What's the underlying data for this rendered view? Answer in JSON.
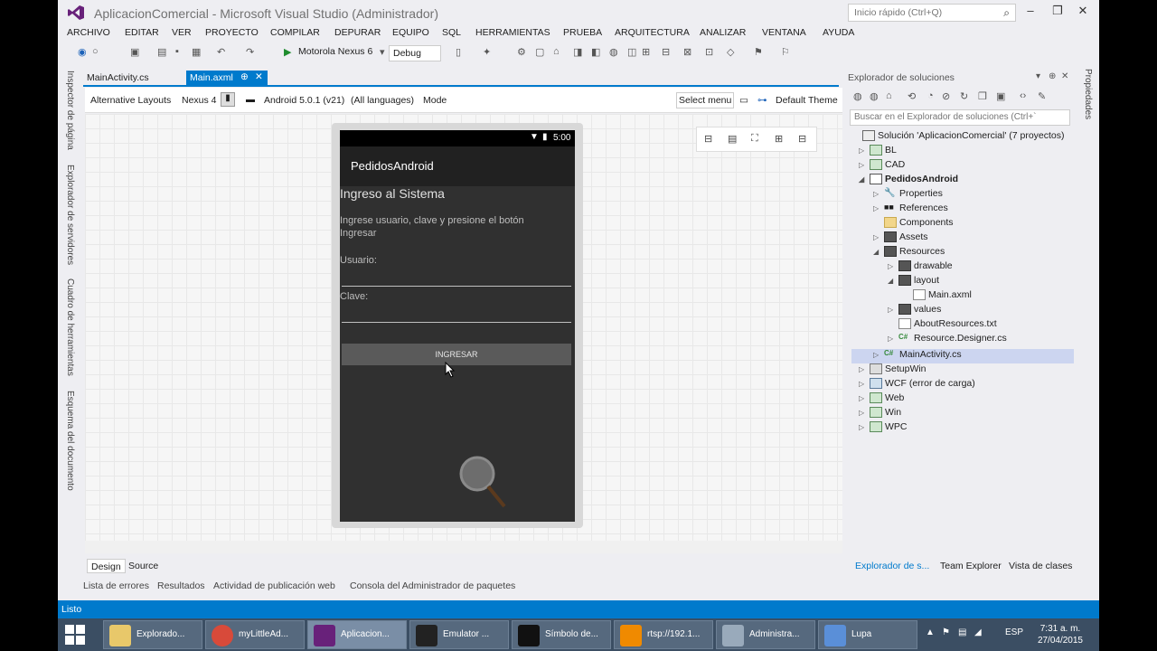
{
  "window": {
    "title": "AplicacionComercial - Microsoft Visual Studio (Administrador)",
    "quick_launch": "Inicio rápido (Ctrl+Q)"
  },
  "menu": [
    "ARCHIVO",
    "EDITAR",
    "VER",
    "PROYECTO",
    "COMPILAR",
    "DEPURAR",
    "EQUIPO",
    "SQL",
    "HERRAMIENTAS",
    "PRUEBA",
    "ARQUITECTURA",
    "ANALIZAR",
    "VENTANA",
    "AYUDA"
  ],
  "toolbar": {
    "device": "Motorola Nexus 6",
    "config": "Debug"
  },
  "left_tabs": [
    "Inspector de página",
    "Explorador de servidores",
    "Cuadro de herramientas",
    "Esquema del documento"
  ],
  "doc_tabs": [
    {
      "label": "MainActivity.cs"
    },
    {
      "label": "Main.axml"
    }
  ],
  "designer_toolbar": {
    "alt_layouts": "Alternative Layouts",
    "device": "Nexus 4",
    "api": "Android 5.0.1 (v21)",
    "lang": "(All languages)",
    "mode": "Mode",
    "select_menu": "Select menu",
    "theme": "Default Theme"
  },
  "phone": {
    "time": "5:00",
    "app_title": "PedidosAndroid",
    "heading": "Ingreso al Sistema",
    "instructions": "Ingrese usuario, clave y presione el botón Ingresar",
    "user_label": "Usuario:",
    "pass_label": "Clave:",
    "button": "INGRESAR"
  },
  "solution_explorer": {
    "title": "Explorador de soluciones",
    "search": "Buscar en el Explorador de soluciones (Ctrl+`",
    "nodes": [
      {
        "label": "Solución 'AplicacionComercial' (7 proyectos)",
        "icon": "solution-icon"
      },
      {
        "label": "BL",
        "icon": "project-icon"
      },
      {
        "label": "CAD",
        "icon": "project-icon"
      },
      {
        "label": "PedidosAndroid",
        "icon": "android-project-icon"
      },
      {
        "label": "Properties",
        "icon": "wrench-icon"
      },
      {
        "label": "References",
        "icon": "references-icon"
      },
      {
        "label": "Components",
        "icon": "folder-icon"
      },
      {
        "label": "Assets",
        "icon": "folder-icon"
      },
      {
        "label": "Resources",
        "icon": "folder-icon"
      },
      {
        "label": "drawable",
        "icon": "folder-icon"
      },
      {
        "label": "layout",
        "icon": "folder-icon"
      },
      {
        "label": "Main.axml",
        "icon": "file-icon"
      },
      {
        "label": "values",
        "icon": "folder-icon"
      },
      {
        "label": "AboutResources.txt",
        "icon": "file-icon"
      },
      {
        "label": "Resource.Designer.cs",
        "icon": "csharp-file-icon"
      },
      {
        "label": "MainActivity.cs",
        "icon": "csharp-file-icon"
      },
      {
        "label": "SetupWin",
        "icon": "setup-project-icon"
      },
      {
        "label": "WCF (error de carga)",
        "icon": "project-icon"
      },
      {
        "label": "Web",
        "icon": "web-project-icon"
      },
      {
        "label": "Win",
        "icon": "project-icon"
      },
      {
        "label": "WPC",
        "icon": "project-icon"
      }
    ],
    "bottom_tabs": [
      "Explorador de s...",
      "Team Explorer",
      "Vista de clases"
    ]
  },
  "right_tab": "Propiedades",
  "design_tabs": [
    "Design",
    "Source"
  ],
  "bottom_tabs": [
    "Lista de errores",
    "Resultados",
    "Actividad de publicación web",
    "Consola del Administrador de paquetes"
  ],
  "status": "Listo",
  "taskbar": {
    "items": [
      "Explorado...",
      "myLittleAd...",
      "Aplicacion...",
      "Emulator ...",
      "Símbolo de...",
      "rtsp://192.1...",
      "Administra...",
      "Lupa"
    ],
    "lang": "ESP",
    "time": "7:31 a. m.",
    "date": "27/04/2015"
  },
  "colors": {
    "accent": "#007acc",
    "selection": "#ccd5f0",
    "taskbar": "#3b4e63"
  }
}
